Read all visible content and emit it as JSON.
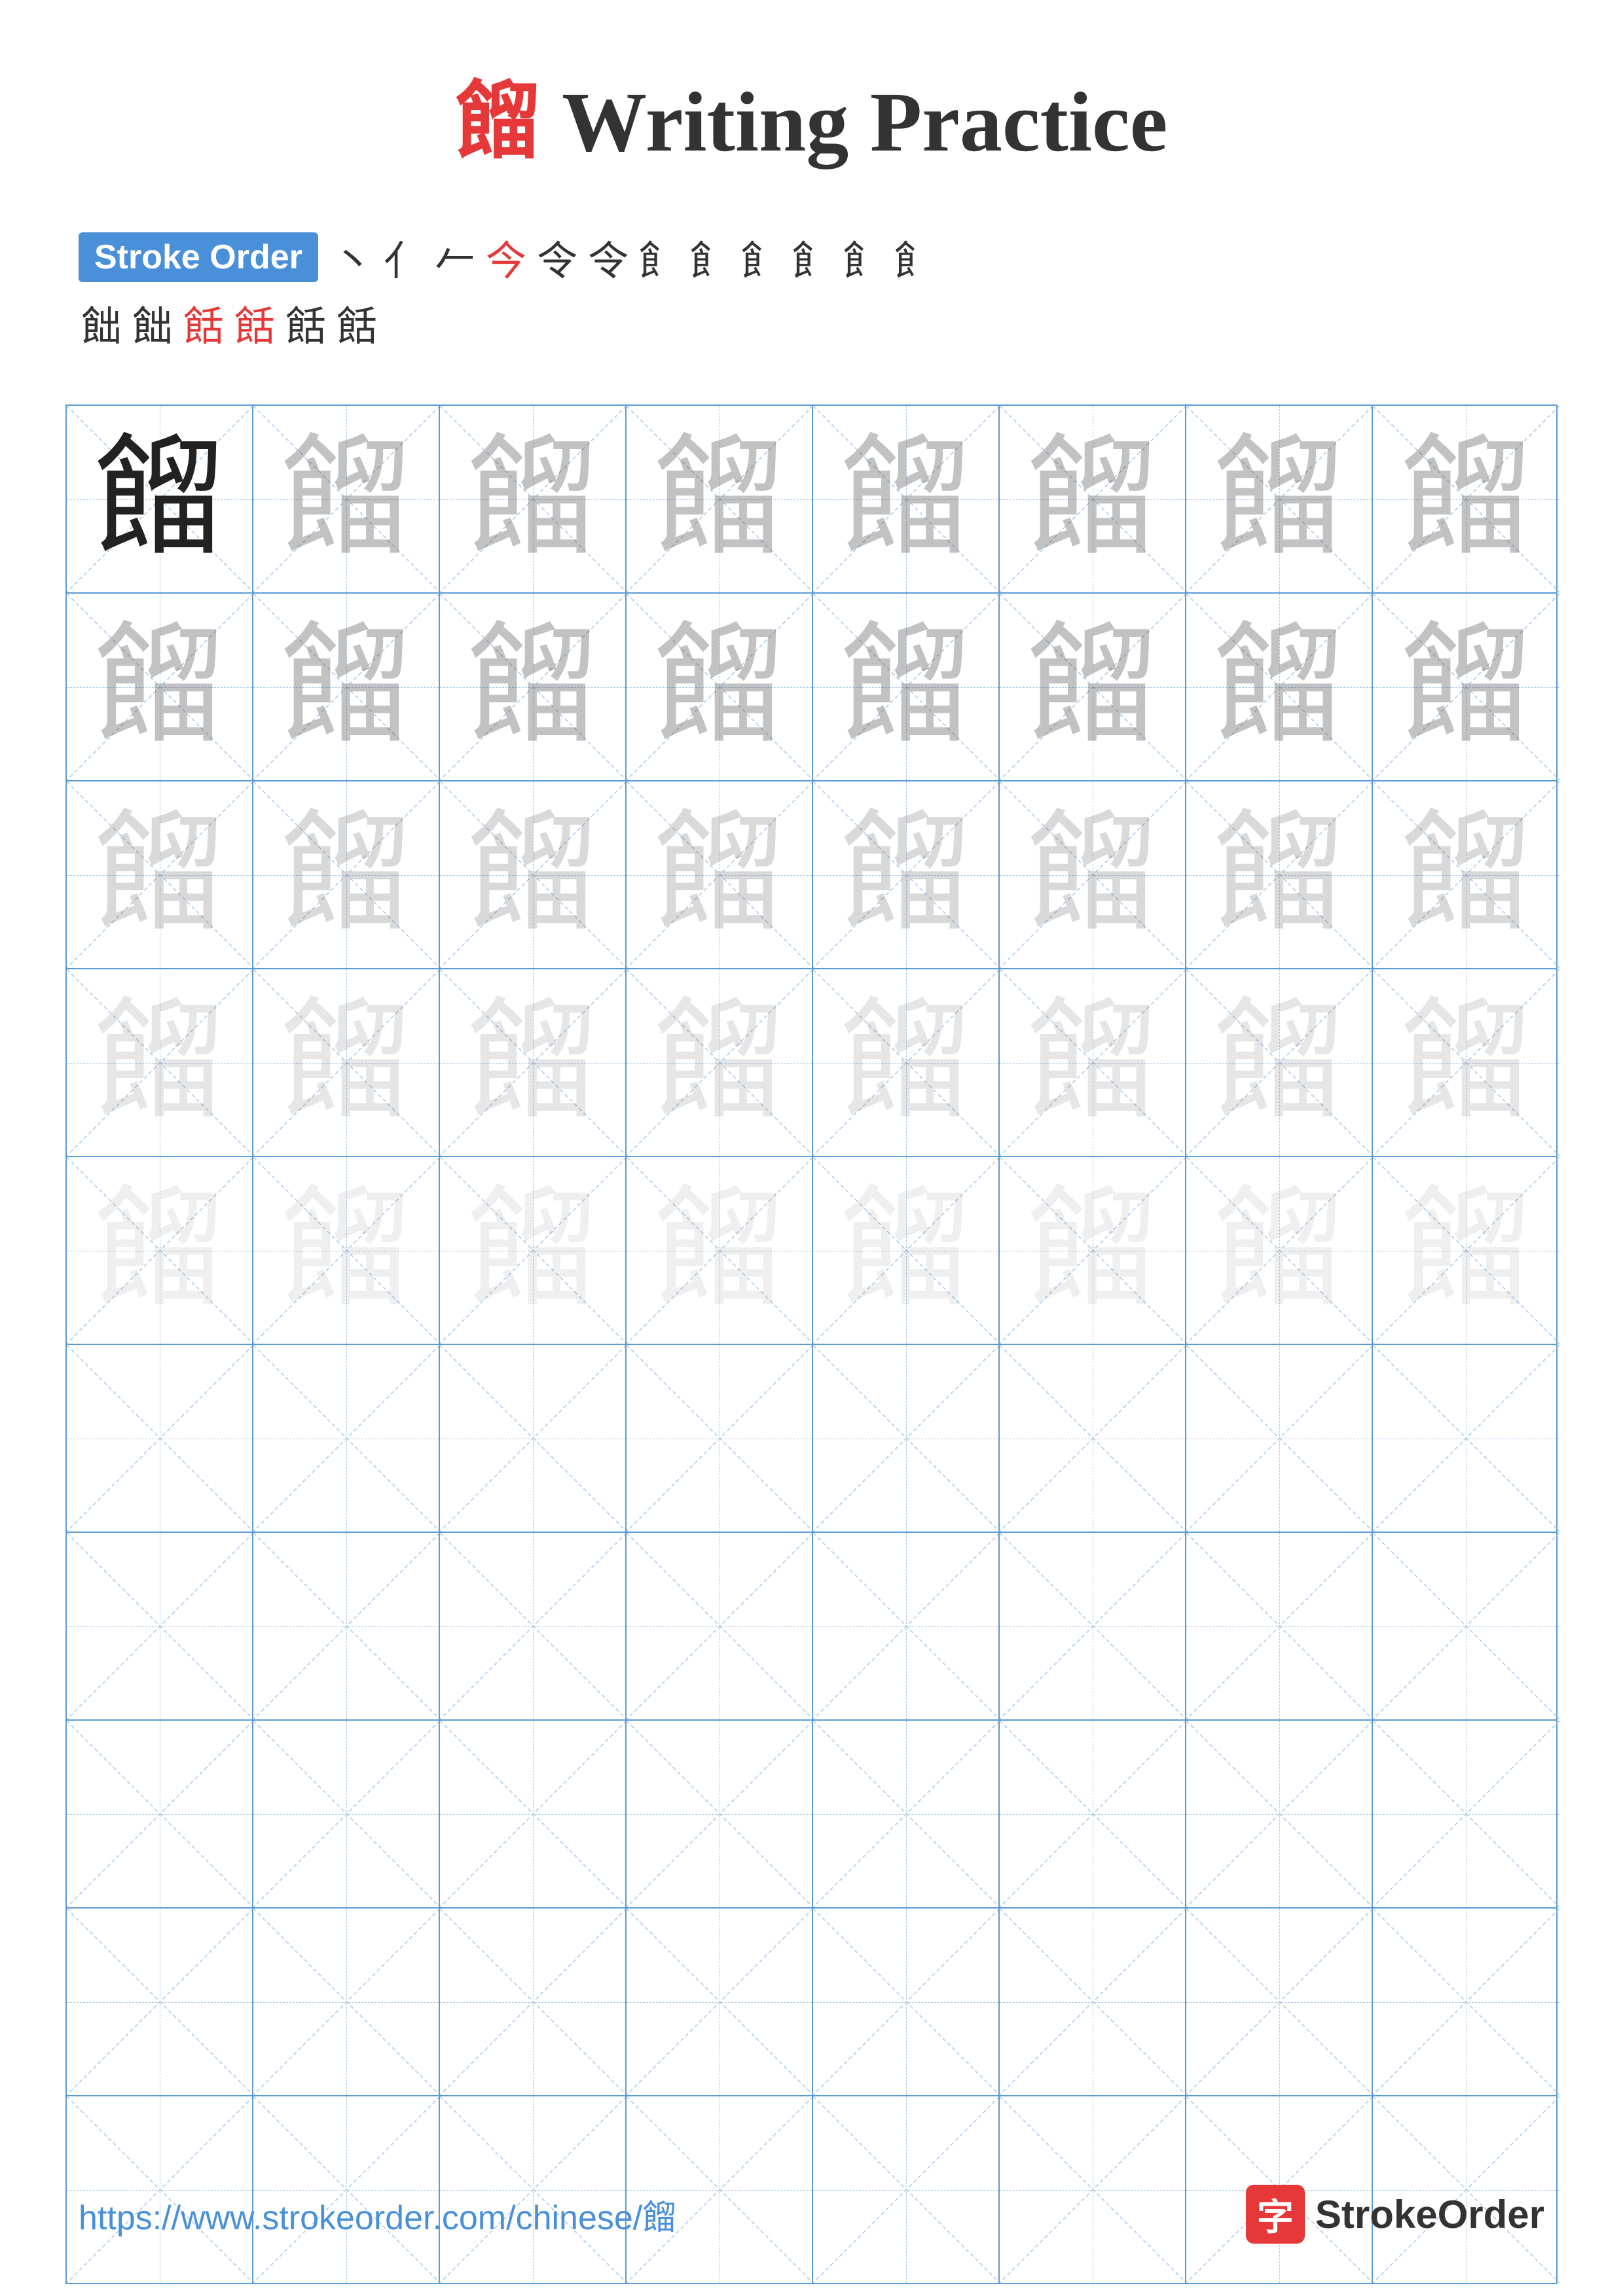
{
  "title": {
    "char": "餾",
    "suffix": " Writing Practice"
  },
  "stroke_order": {
    "badge_label": "Stroke Order",
    "strokes_row1": [
      "丶",
      "亻",
      "𠂉",
      "今",
      "令",
      "令",
      "飠",
      "飠",
      "飠",
      "飠",
      "飠",
      "飠"
    ],
    "strokes_row2": [
      "飿",
      "飿",
      "餂",
      "餂",
      "餂",
      "餂"
    ],
    "red_indices_row1": [
      3
    ],
    "red_indices_row2": [
      2,
      3
    ]
  },
  "main_char": "餾",
  "grid": {
    "cols": 8,
    "practice_rows": 5,
    "empty_rows": 5
  },
  "footer": {
    "url": "https://www.strokeorder.com/chinese/餾",
    "logo_char": "字",
    "logo_text": "StrokeOrder"
  }
}
